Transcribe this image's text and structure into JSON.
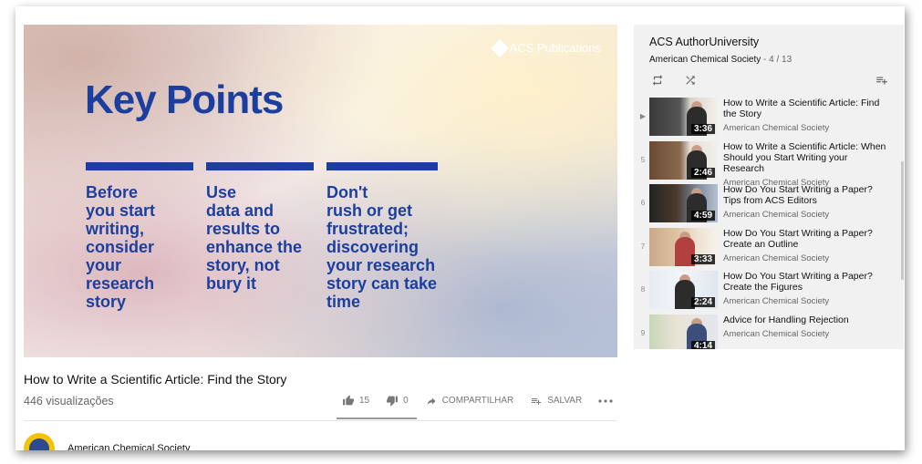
{
  "video": {
    "logo_text": "ACS Publications",
    "heading": "Key Points",
    "columns": [
      "Before\nyou start\nwriting,\nconsider\nyour\nresearch\nstory",
      "Use\ndata and\nresults to\nenhance the\nstory, not\nbury it",
      "Don't\nrush or get\nfrustrated;\ndiscovering\nyour research\nstory can take\ntime"
    ],
    "brand_color": "#1c3f9f"
  },
  "info": {
    "title": "How to Write a Scientific Article: Find the Story",
    "views": "446 visualizações",
    "likes": "15",
    "dislikes": "0",
    "share_label": "COMPARTILHAR",
    "save_label": "SALVAR"
  },
  "channel": {
    "name": "American Chemical Society"
  },
  "playlist": {
    "title": "ACS AuthorUniversity",
    "owner": "American Chemical Society",
    "position": "- 4 / 13",
    "items": [
      {
        "index": "▶",
        "title": "How to Write a Scientific Article: Find the Story",
        "channel": "American Chemical Society",
        "duration": "3:36"
      },
      {
        "index": "5",
        "title": "How to Write a Scientific Article: When Should you Start Writing your Research",
        "channel": "American Chemical Society",
        "duration": "2:46"
      },
      {
        "index": "6",
        "title": "How Do You Start Writing a Paper? Tips from ACS Editors",
        "channel": "American Chemical Society",
        "duration": "4:59"
      },
      {
        "index": "7",
        "title": "How Do You Start Writing a Paper? Create an Outline",
        "channel": "American Chemical Society",
        "duration": "3:33"
      },
      {
        "index": "8",
        "title": "How Do You Start Writing a Paper? Create the Figures",
        "channel": "American Chemical Society",
        "duration": "2:24"
      },
      {
        "index": "9",
        "title": "Advice for Handling Rejection",
        "channel": "American Chemical Society",
        "duration": "4:14"
      }
    ]
  }
}
